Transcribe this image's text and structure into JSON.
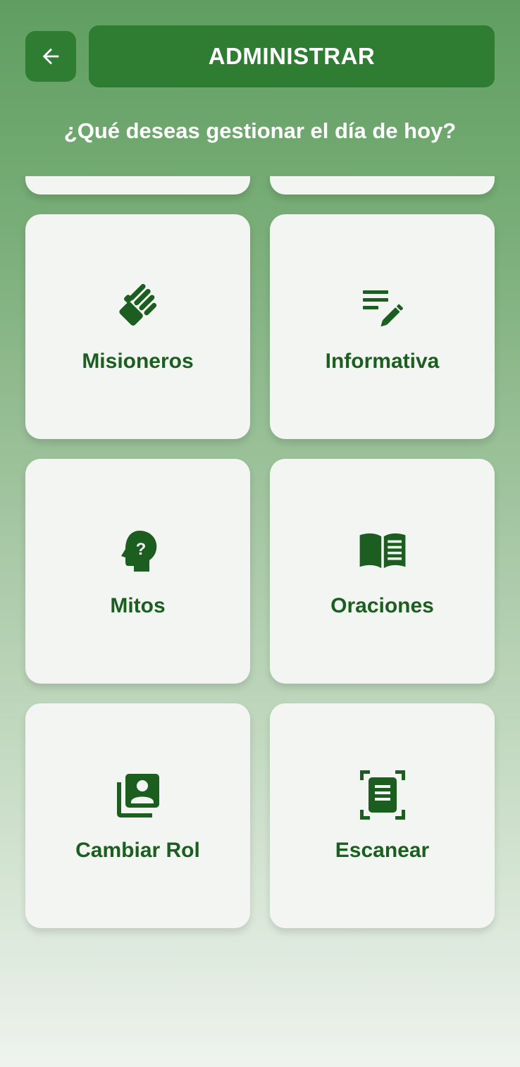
{
  "header": {
    "back_icon": "arrow-left-icon",
    "title": "ADMINISTRAR"
  },
  "subtitle": "¿Qué deseas gestionar el día de hoy?",
  "menu": {
    "items": [
      {
        "label": "Misioneros",
        "icon": "handshake-icon"
      },
      {
        "label": "Informativa",
        "icon": "edit-note-icon"
      },
      {
        "label": "Mitos",
        "icon": "psychology-question-icon"
      },
      {
        "label": "Oraciones",
        "icon": "open-book-icon"
      },
      {
        "label": "Cambiar Rol",
        "icon": "switch-account-icon"
      },
      {
        "label": "Escanear",
        "icon": "document-scanner-icon"
      }
    ]
  },
  "colors": {
    "primary": "#2e7d32",
    "label": "#1b5e20",
    "card": "#f3f5f2"
  }
}
